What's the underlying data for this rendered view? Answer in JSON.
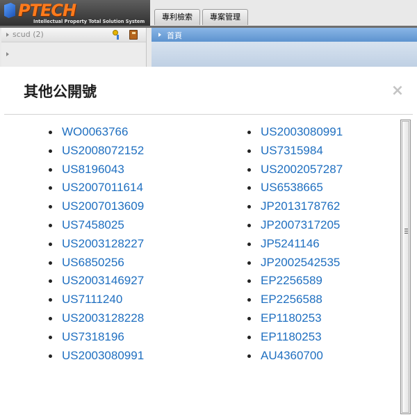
{
  "app": {
    "logo_text": "PTECH",
    "logo_tagline": "Intellectual Property Total Solution System",
    "tabs": [
      {
        "label": "專利檢索"
      },
      {
        "label": "專案管理"
      }
    ]
  },
  "left_panel": {
    "title": "scud  (2)"
  },
  "right_panel": {
    "title": "首頁"
  },
  "modal": {
    "title": "其他公開號",
    "close_label": "×",
    "left_list": [
      "WO0063766",
      "US2008072152",
      "US8196043",
      "US2007011614",
      "US2007013609",
      "US7458025",
      "US2003128227",
      "US6850256",
      "US2003146927",
      "US7111240",
      "US2003128228",
      "US7318196",
      "US2003080991"
    ],
    "right_list": [
      "US2003080991",
      "US7315984",
      "US2002057287",
      "US6538665",
      "JP2013178762",
      "JP2007317205",
      "JP5241146",
      "JP2002542535",
      "EP2256589",
      "EP2256588",
      "EP1180253",
      "EP1180253",
      "AU4360700"
    ]
  },
  "colors": {
    "link": "#1f6fc0",
    "logo_orange": "#ff7b1c",
    "header_blue": "#5d93cf"
  },
  "icons": [
    "expand-triangle-icon",
    "key-icon",
    "book-icon",
    "close-icon",
    "scroll-grip-icon"
  ]
}
